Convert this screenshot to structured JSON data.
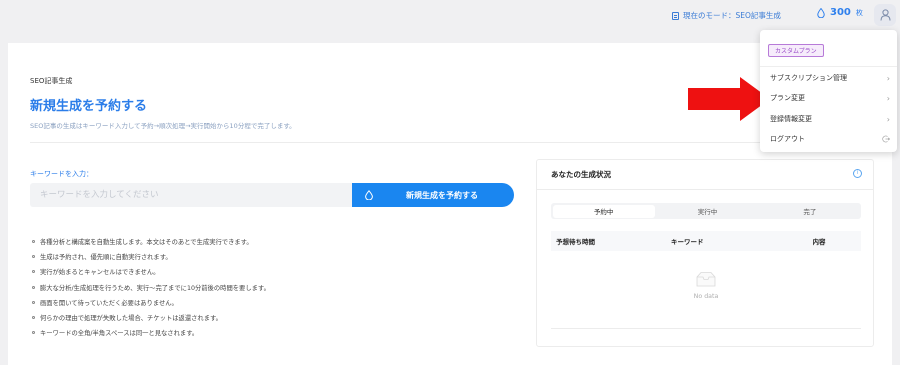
{
  "header": {
    "mode_text": "現在のモード：SEO記事生成",
    "credits_value": "300",
    "credits_unit": "枚"
  },
  "page": {
    "breadcrumb": "SEO記事生成",
    "title": "新規生成を予約する",
    "subtitle": "SEO記事の生成はキーワード入力して予約→順次処理→実行開始から10分程で完了します。"
  },
  "form": {
    "keyword_label": "キーワードを入力：",
    "keyword_placeholder": "キーワードを入力してください",
    "keyword_value": "",
    "reserve_button": "新規生成を予約する"
  },
  "notes": [
    "各種分析と構成案を自動生成します。本文はそのあとで生成実行できます。",
    "生成は予約され、優先順に自動実行されます。",
    "実行が始まるとキャンセルはできません。",
    "膨大な分析/生成処理を行うため、実行〜完了までに10分前後の時間を要します。",
    "画面を開いて待っていただく必要はありません。",
    "何らかの理由で処理が失敗した場合、チケットは返還されます。",
    "キーワードの全角/半角スペースは同一と見なされます。"
  ],
  "status_panel": {
    "title": "あなたの生成状況",
    "tabs": [
      "予約中",
      "実行中",
      "完了"
    ],
    "active_tab": "予約中",
    "columns": [
      "予想待ち時間",
      "キーワード",
      "内容"
    ],
    "empty_text": "No data"
  },
  "menu": {
    "plan_badge": "カスタムプラン",
    "items": [
      {
        "label": "サブスクリプション管理",
        "icon": "chevron-right-icon"
      },
      {
        "label": "プラン変更",
        "icon": "chevron-right-icon"
      },
      {
        "label": "登録情報変更",
        "icon": "chevron-right-icon"
      },
      {
        "label": "ログアウト",
        "icon": "logout-icon"
      }
    ]
  },
  "colors": {
    "accent": "#2b7de9",
    "button": "#1a86f0",
    "plan_badge": "#9a4cc8",
    "annotation_arrow": "#ee1111"
  }
}
